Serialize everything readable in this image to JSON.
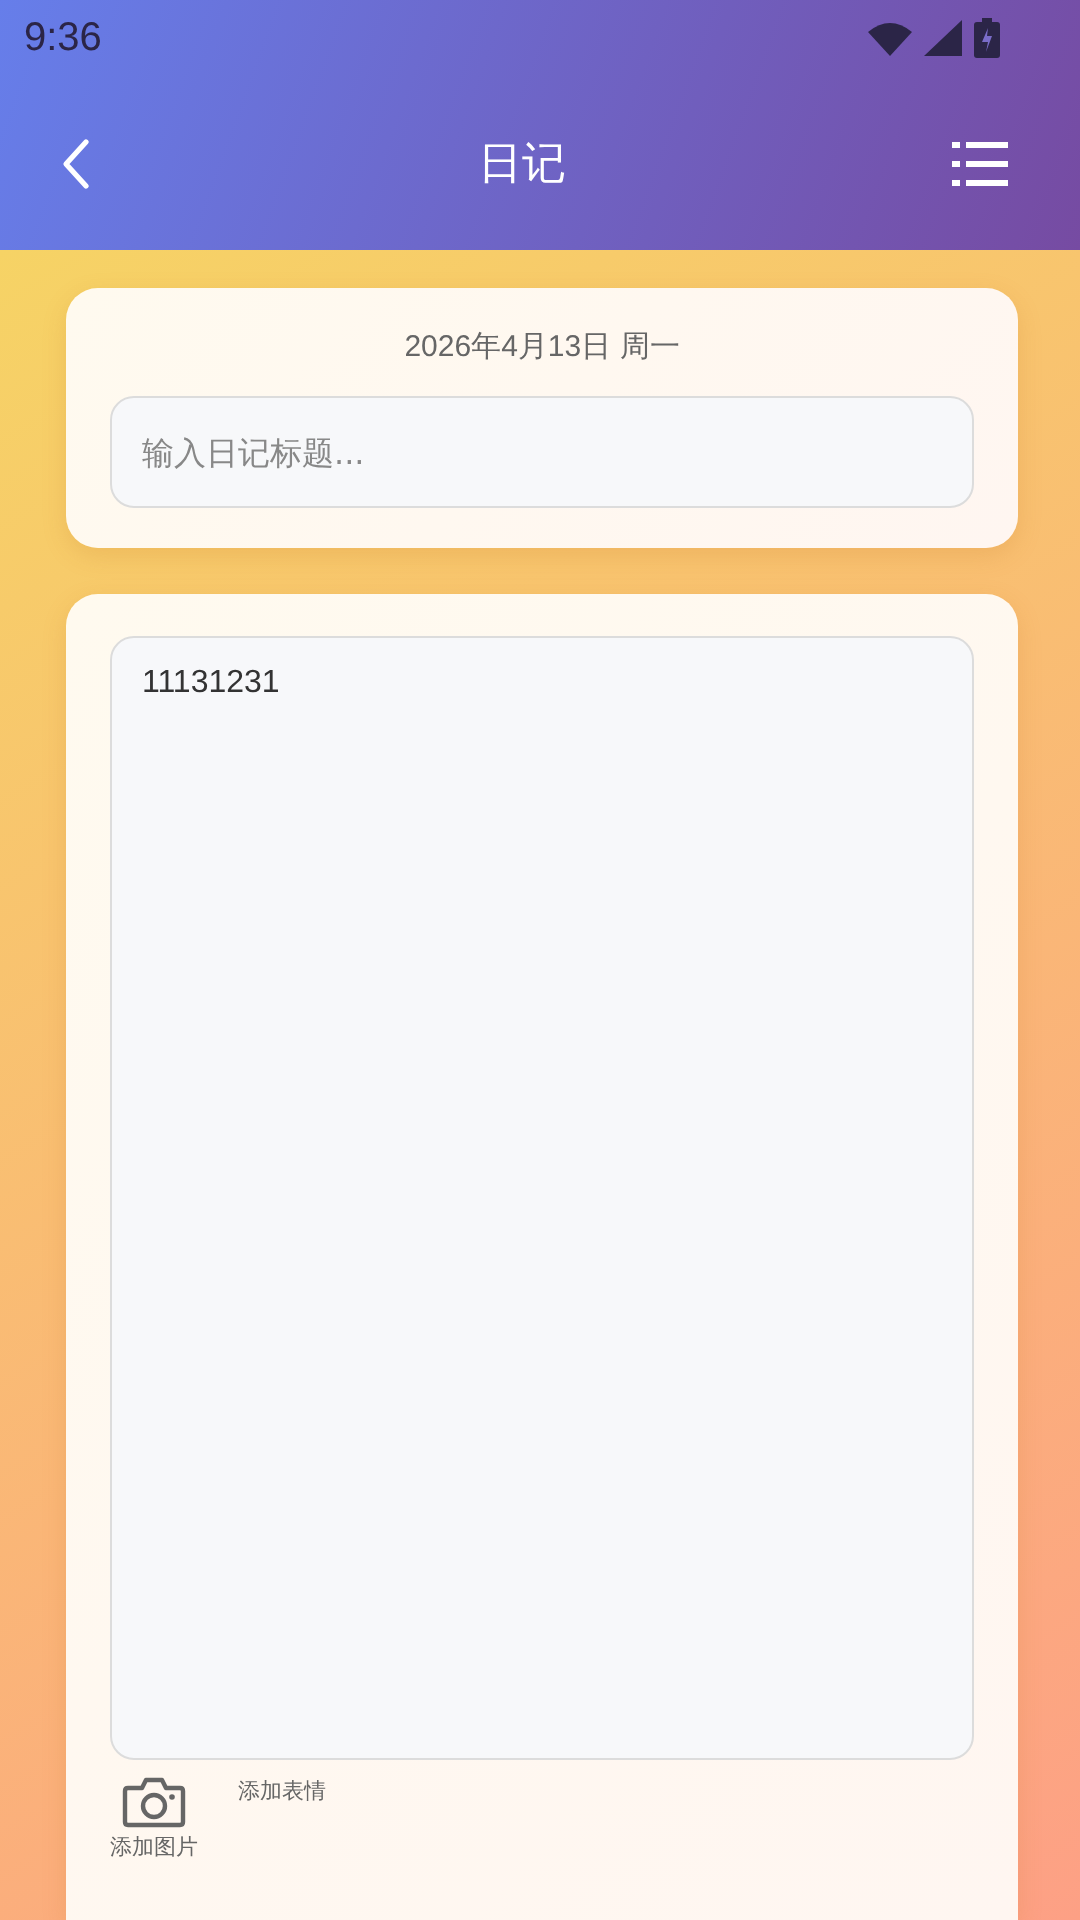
{
  "status_bar": {
    "time": "9:36"
  },
  "header": {
    "title": "日记"
  },
  "date": "2026年4月13日 周一",
  "title_field": {
    "placeholder": "输入日记标题..."
  },
  "content_field": {
    "value": "11131231"
  },
  "tools": [
    {
      "kind": "camera",
      "label": "添加图片"
    },
    {
      "kind": "emoji",
      "label": "添加表情"
    }
  ]
}
